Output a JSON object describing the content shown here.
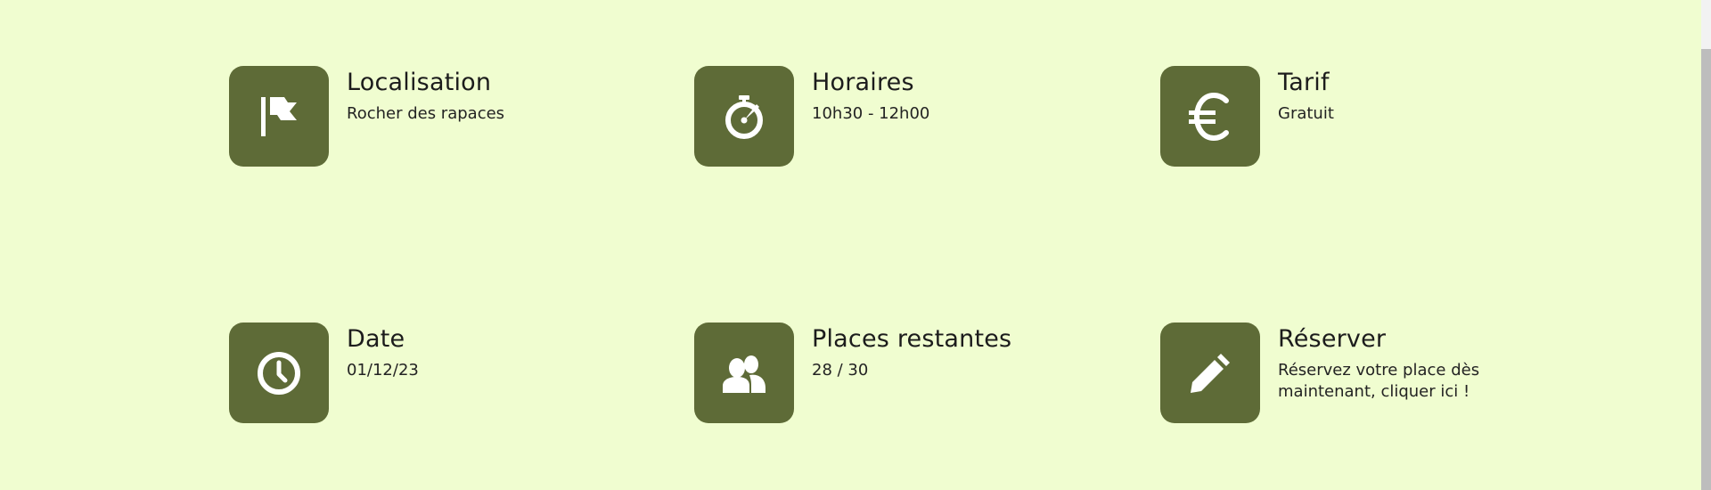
{
  "items": [
    {
      "title": "Localisation",
      "value": "Rocher des rapaces",
      "icon": "flag-icon"
    },
    {
      "title": "Horaires",
      "value": "10h30 - 12h00",
      "icon": "stopwatch-icon"
    },
    {
      "title": "Tarif",
      "value": "Gratuit",
      "icon": "euro-icon"
    },
    {
      "title": "Date",
      "value": "01/12/23",
      "icon": "clock-icon"
    },
    {
      "title": "Places restantes",
      "value": "28 / 30",
      "icon": "people-icon"
    },
    {
      "title": "Réserver",
      "value": "Réservez votre place dès maintenant, cliquer ici !",
      "icon": "pencil-icon"
    }
  ],
  "colors": {
    "background": "#f0fdd0",
    "icon_box": "#5e6b37",
    "icon_fg": "#ffffff",
    "text": "#1c1c1c"
  }
}
